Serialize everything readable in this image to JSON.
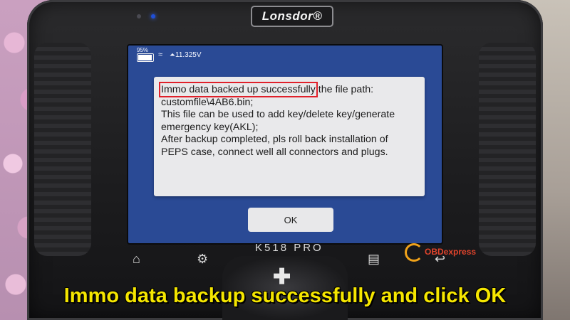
{
  "device": {
    "brand": "Lonsdor®",
    "model": "K518 PRO"
  },
  "statusbar": {
    "battery_percent": "95%",
    "voltage": "11.325V"
  },
  "dialog": {
    "highlight_text": "Immo data backed up successfully",
    "line1_rest": " the file path:",
    "line2": "customfile\\4AB6.bin;",
    "line3": "This file can be used to add key/delete key/generate",
    "line4": "emergency key(AKL);",
    "line5": "After backup completed, pls roll back installation of",
    "line6": "PEPS case, connect well all connectors and plugs.",
    "ok_label": "OK"
  },
  "watermark": "OBDexpress",
  "caption": "Immo data backup successfully and click OK",
  "colors": {
    "screen_bg": "#2a4a95",
    "dialog_bg": "#e9e9eb",
    "highlight": "#e0202a",
    "caption": "#f5e600"
  },
  "icons": [
    "battery-icon",
    "wifi-icon",
    "home-icon",
    "gear-icon",
    "message-icon",
    "back-icon",
    "dpad-icon"
  ]
}
